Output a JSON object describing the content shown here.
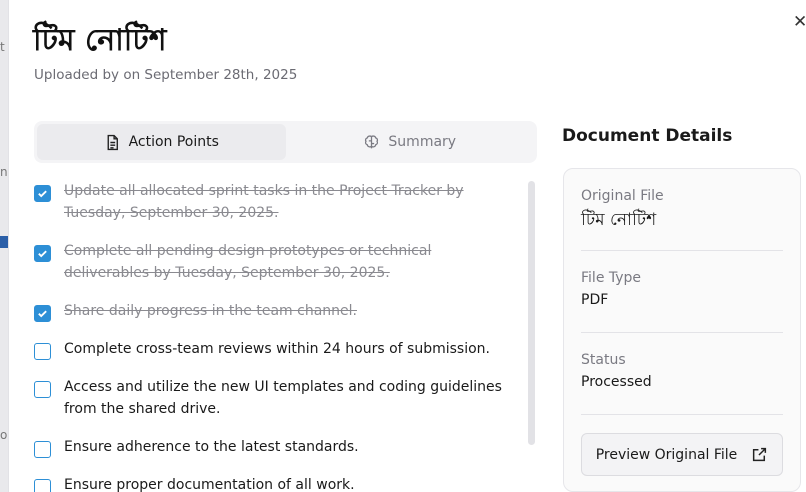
{
  "document": {
    "title": "টিম নোটিশ",
    "subtitle": "Uploaded by on September 28th, 2025"
  },
  "tabs": [
    {
      "label": "Action Points",
      "icon": "document-icon",
      "active": true
    },
    {
      "label": "Summary",
      "icon": "brain-icon",
      "active": false
    }
  ],
  "action_points": [
    {
      "text": "Update all allocated sprint tasks in the Project Tracker by Tuesday, September 30, 2025.",
      "checked": true
    },
    {
      "text": "Complete all pending design prototypes or technical deliverables by Tuesday, September 30, 2025.",
      "checked": true
    },
    {
      "text": "Share daily progress in the team channel.",
      "checked": true
    },
    {
      "text": "Complete cross-team reviews within 24 hours of submission.",
      "checked": false
    },
    {
      "text": "Access and utilize the new UI templates and coding guidelines from the shared drive.",
      "checked": false
    },
    {
      "text": "Ensure adherence to the latest standards.",
      "checked": false
    },
    {
      "text": "Ensure proper documentation of all work.",
      "checked": false
    }
  ],
  "details": {
    "heading": "Document Details",
    "original_file_label": "Original File",
    "original_file_value": "টিম নোটিশ",
    "file_type_label": "File Type",
    "file_type_value": "PDF",
    "status_label": "Status",
    "status_value": "Processed",
    "preview_label": "Preview Original File"
  },
  "colors": {
    "accent": "#2d8fd6"
  }
}
